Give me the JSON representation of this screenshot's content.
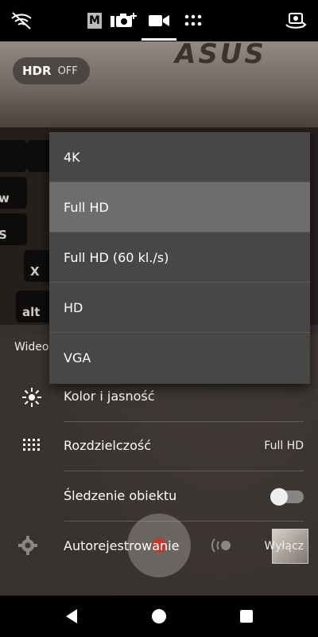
{
  "camera": {
    "hdr": {
      "label": "HDR",
      "state": "OFF"
    },
    "modes": [
      {
        "name": "manual",
        "glyph": "M"
      },
      {
        "name": "photo"
      },
      {
        "name": "video",
        "active": true
      },
      {
        "name": "more"
      }
    ],
    "viewfinder": {
      "brand_text": "ASUS",
      "keys": [
        "w",
        "S",
        "X",
        "alt"
      ]
    }
  },
  "dropdown": {
    "options": [
      "4K",
      "Full HD",
      "Full HD (60 kl./s)",
      "HD",
      "VGA"
    ],
    "selected_index": 1
  },
  "settings": {
    "section_label": "Wideo",
    "rows": [
      {
        "label": "Kolor i jasność",
        "value": ""
      },
      {
        "label": "Rozdzielczość",
        "value": "Full HD"
      },
      {
        "label": "Śledzenie obiektu",
        "value": "",
        "toggle": false
      },
      {
        "label": "Autorejestrowanie",
        "value": "Wyłącz"
      }
    ]
  },
  "colors": {
    "dropdown_bg": "#474747",
    "dropdown_selected": "#6d6d6d",
    "shutter_dot": "#c0392b"
  }
}
